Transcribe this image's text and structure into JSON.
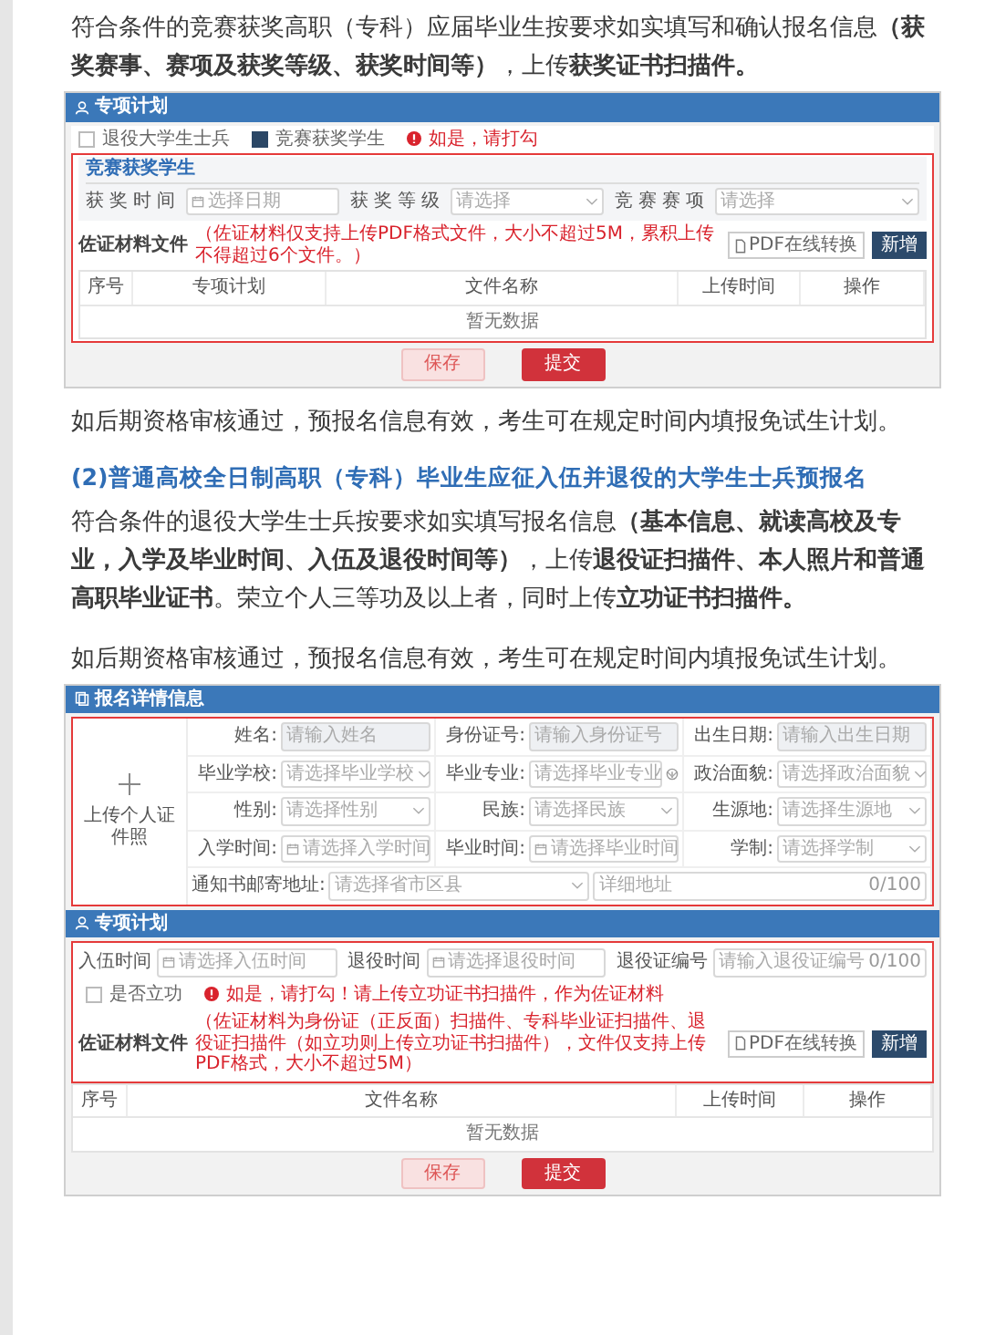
{
  "intro": "符合条件的竞赛获奖高职（专科）应届毕业生按要求如实填写和确认报名信息**（获奖赛事、赛项及获奖等级、获奖时间等）**，上传**获奖证书扫描件。**",
  "form_1": {
    "title": "专项计划",
    "categories": [
      {
        "label": "退役大学生士兵",
        "checked": false
      },
      {
        "label": "竞赛获奖学生",
        "checked": true
      }
    ],
    "hint": "如是，请打勾",
    "section_title": "竞赛获奖学生",
    "fields": [
      {
        "label": "获奖时间",
        "kind": "date",
        "placeholder": "选择日期"
      },
      {
        "label": "获奖等级",
        "kind": "select",
        "placeholder": "请选择"
      },
      {
        "label": "竞赛赛项",
        "kind": "select",
        "placeholder": "请选择"
      }
    ],
    "files": {
      "label": "佐证材料文件",
      "note": "（佐证材料仅支持上传PDF格式文件，大小不超过5M，累积上传不得超过6个文件。）",
      "convert_button": "PDF在线转换",
      "add_button": "新增"
    },
    "table": {
      "columns": [
        "序号",
        "专项计划",
        "文件名称",
        "上传时间",
        "操作"
      ],
      "empty_text": "暂无数据"
    },
    "buttons": [
      {
        "label": "保存",
        "kind": "secondary"
      },
      {
        "label": "提交",
        "kind": "primary"
      }
    ]
  },
  "note_1": "如后期资格审核通过，预报名信息有效，考生可在规定时间内填报免试生计划。",
  "heading": "(2)普通高校全日制高职（专科）毕业生应征入伍并退役的大学生士兵预报名",
  "body": "符合条件的退役大学生士兵按要求如实填写报名信息**（基本信息、就读高校及专业，入学及毕业时间、入伍及退役时间等）**，上传**退役证扫描件、本人照片和普通高职毕业证书**。荣立个人三等功及以上者，同时上传**立功证书扫描件。**",
  "note_2": "如后期资格审核通过，预报名信息有效，考生可在规定时间内填报免试生计划。",
  "form_2": {
    "details": {
      "title": "报名详情信息",
      "photo_label": "上传个人证件照",
      "fields": [
        {
          "label": "姓名:",
          "kind": "text",
          "placeholder": "请输入姓名",
          "disabled": true,
          "help_icon": false
        },
        {
          "label": "身份证号:",
          "kind": "text",
          "placeholder": "请输入身份证号",
          "disabled": true,
          "help_icon": false
        },
        {
          "label": "出生日期:",
          "kind": "text",
          "placeholder": "请输入出生日期",
          "disabled": true,
          "help_icon": false
        },
        {
          "label": "毕业学校:",
          "kind": "select",
          "placeholder": "请选择毕业学校",
          "disabled": false,
          "help_icon": false
        },
        {
          "label": "毕业专业:",
          "kind": "select",
          "placeholder": "请选择毕业专业",
          "disabled": false,
          "help_icon": true
        },
        {
          "label": "政治面貌:",
          "kind": "select",
          "placeholder": "请选择政治面貌",
          "disabled": false,
          "help_icon": false
        },
        {
          "label": "性别:",
          "kind": "select",
          "placeholder": "请选择性别",
          "disabled": false,
          "help_icon": false
        },
        {
          "label": "民族:",
          "kind": "select",
          "placeholder": "请选择民族",
          "disabled": false,
          "help_icon": false
        },
        {
          "label": "生源地:",
          "kind": "select",
          "placeholder": "请选择生源地",
          "disabled": false,
          "help_icon": false
        },
        {
          "label": "入学时间:",
          "kind": "date",
          "placeholder": "请选择入学时间",
          "disabled": false,
          "help_icon": false
        },
        {
          "label": "毕业时间:",
          "kind": "date",
          "placeholder": "请选择毕业时间",
          "disabled": false,
          "help_icon": false
        },
        {
          "label": "学制:",
          "kind": "select",
          "placeholder": "请选择学制",
          "disabled": false,
          "help_icon": false
        }
      ],
      "address": {
        "label": "通知书邮寄地址:",
        "region_placeholder": "请选择省市区县",
        "detail_placeholder": "详细地址",
        "counter": "0/100"
      }
    },
    "service": {
      "title": "专项计划",
      "fields": [
        {
          "label": "入伍时间",
          "kind": "date",
          "placeholder": "请选择入伍时间"
        },
        {
          "label": "退役时间",
          "kind": "date",
          "placeholder": "请选择退役时间"
        },
        {
          "label": "退役证编号",
          "kind": "text",
          "placeholder": "请输入退役证编号",
          "counter": "0/100"
        }
      ],
      "merit": {
        "label": "是否立功",
        "checked": false,
        "hint": "如是，请打勾！请上传立功证书扫描件，作为佐证材料"
      },
      "files": {
        "label": "佐证材料文件",
        "note": "（佐证材料为身份证（正反面）扫描件、专科毕业证扫描件、退役证扫描件（如立功则上传立功证书扫描件），文件仅支持上传PDF格式，大小不超过5M）",
        "convert_button": "PDF在线转换",
        "add_button": "新增"
      },
      "table": {
        "columns": [
          "序号",
          "文件名称",
          "上传时间",
          "操作"
        ],
        "empty_text": "暂无数据"
      },
      "buttons": [
        {
          "label": "保存",
          "kind": "secondary"
        },
        {
          "label": "提交",
          "kind": "primary"
        }
      ]
    }
  }
}
